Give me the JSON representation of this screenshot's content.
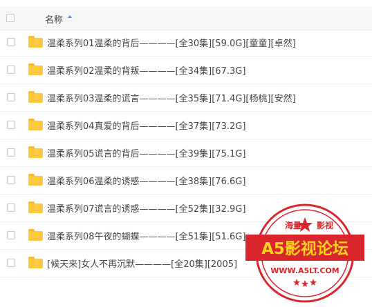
{
  "header": {
    "column_name": "名称"
  },
  "files": [
    {
      "name": "温柔系列01温柔的背后————[全30集][59.0G][童童][卓然]"
    },
    {
      "name": "温柔系列02温柔的背叛————[全34集][67.3G]"
    },
    {
      "name": "温柔系列03温柔的谎言————[全35集][71.4G][杨桃][安然]"
    },
    {
      "name": "温柔系列04真爱的背后————[全37集][73.2G]"
    },
    {
      "name": "温柔系列05谎言的背后————[全39集][75.1G]"
    },
    {
      "name": "温柔系列06温柔的诱惑————[全38集][76.6G]"
    },
    {
      "name": "温柔系列07谎言的诱惑————[全52集][32.9G]"
    },
    {
      "name": "温柔系列08午夜的蝴蝶————[全51集][51.6G]"
    },
    {
      "name": "[候天来]女人不再沉默————[全20集][2005]"
    }
  ],
  "watermark": {
    "top_left": "海量",
    "top_right": "影视",
    "title": "A5影视论坛",
    "url": "WWW.A5LT.COM",
    "colors": {
      "red": "#d9262c",
      "yellow": "#ffd21f"
    }
  }
}
